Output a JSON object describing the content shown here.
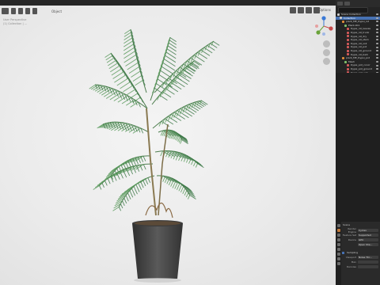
{
  "header": {
    "mode_label": "Object",
    "view_options": "Options"
  },
  "viewport": {
    "overlay_lines": [
      "User Perspective",
      "(1) Collection | ...",
      "",
      ""
    ]
  },
  "outliner": {
    "search_placeholder": "",
    "items": [
      {
        "label": "Scene Collection",
        "type": "collection",
        "indent": 0,
        "selected": false
      },
      {
        "label": "Collection",
        "type": "collection",
        "indent": 1,
        "selected": true
      },
      {
        "label": "plant_ME_Dypsi_lut",
        "type": "object",
        "indent": 2,
        "selected": false
      },
      {
        "label": "Plant-001",
        "type": "mesh",
        "indent": 3,
        "selected": false
      },
      {
        "label": "Dypsi_lut_leaves",
        "type": "material",
        "indent": 4,
        "selected": false
      },
      {
        "label": "Dypsi_lut_trunk",
        "type": "material",
        "indent": 4,
        "selected": false
      },
      {
        "label": "Dypsi_lut_dry",
        "type": "material",
        "indent": 4,
        "selected": false
      },
      {
        "label": "Dypsi_lut_stem",
        "type": "material",
        "indent": 4,
        "selected": false
      },
      {
        "label": "Dypsi_lut_soil",
        "type": "material",
        "indent": 4,
        "selected": false
      },
      {
        "label": "Dypsi_lut_pot",
        "type": "material",
        "indent": 4,
        "selected": false
      },
      {
        "label": "Dypsi_lut_ground",
        "type": "material",
        "indent": 4,
        "selected": false
      },
      {
        "label": "Dypsi_lut_bark",
        "type": "material",
        "indent": 4,
        "selected": false
      },
      {
        "label": "plant_ME_Dypsi_pot",
        "type": "object",
        "indent": 2,
        "selected": false
      },
      {
        "label": "Mesh",
        "type": "mesh",
        "indent": 3,
        "selected": false
      },
      {
        "label": "Dypsi_pot_concr",
        "type": "material",
        "indent": 4,
        "selected": false
      },
      {
        "label": "Dypsi_pot_ground",
        "type": "material",
        "indent": 4,
        "selected": false
      },
      {
        "label": "Dypsi_pot_soil",
        "type": "material",
        "indent": 4,
        "selected": false
      }
    ]
  },
  "properties": {
    "title": "Scene",
    "rows": [
      {
        "label": "Render Engine",
        "value": "Cycles"
      },
      {
        "label": "Feature Set",
        "value": "Supported"
      },
      {
        "label": "Device",
        "value": "GPU"
      },
      {
        "label": "",
        "value": "Open Sha..."
      }
    ],
    "section": "Sampling",
    "sub_rows": [
      {
        "label": "Viewport",
        "value": "Noise Thr..."
      },
      {
        "label": "Max",
        "value": ""
      },
      {
        "label": "Denoise",
        "value": ""
      }
    ]
  },
  "colors": {
    "viewport_bg": "#ececec",
    "panel_bg": "#242424",
    "selection": "#4772b3",
    "pot": "#4a4a4a",
    "leaf": "#3f7a49"
  }
}
